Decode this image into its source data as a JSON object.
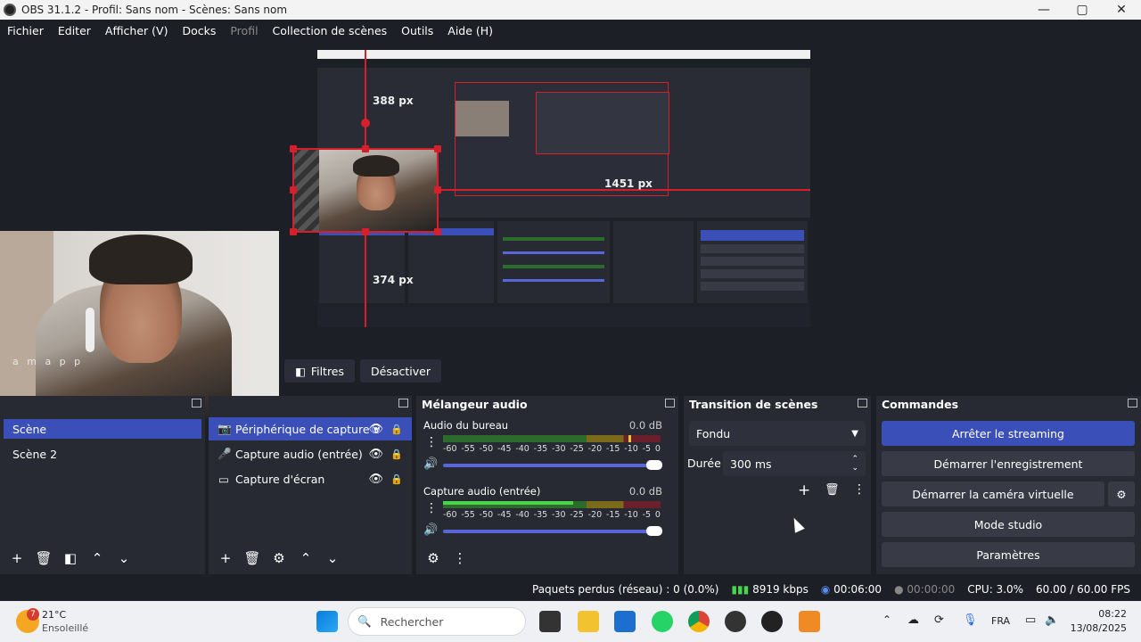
{
  "window": {
    "title": "OBS 31.1.2 - Profil: Sans nom - Scènes: Sans nom"
  },
  "menu": [
    "Fichier",
    "Editer",
    "Afficher (V)",
    "Docks",
    "Profil",
    "Collection de scènes",
    "Outils",
    "Aide (H)"
  ],
  "preview": {
    "measure_top": "388 px",
    "measure_bottom": "374 px",
    "measure_right": "1451 px"
  },
  "webcam": {
    "watermark": "a m a p p"
  },
  "filter_bar": {
    "filters": "Filtres",
    "deactivate": "Désactiver"
  },
  "scenes": {
    "items": [
      "Scène",
      "Scène 2"
    ]
  },
  "sources": {
    "items": [
      "Périphérique de capture v",
      "Capture audio (entrée)",
      "Capture d'écran"
    ]
  },
  "mixer": {
    "title": "Mélangeur audio",
    "channels": [
      {
        "name": "Audio du bureau",
        "db": "0.0 dB",
        "level": 0.0
      },
      {
        "name": "Capture audio (entrée)",
        "db": "0.0 dB",
        "level": 0.6
      }
    ],
    "scale": [
      "-60",
      "-55",
      "-50",
      "-45",
      "-40",
      "-35",
      "-30",
      "-25",
      "-20",
      "-15",
      "-10",
      "-5",
      "0"
    ]
  },
  "transitions": {
    "title": "Transition de scènes",
    "selected": "Fondu",
    "duration_label": "Durée",
    "duration_value": "300 ms"
  },
  "commands": {
    "title": "Commandes",
    "stop_streaming": "Arrêter le streaming",
    "start_recording": "Démarrer l'enregistrement",
    "start_virtualcam": "Démarrer la caméra virtuelle",
    "studio_mode": "Mode studio",
    "settings": "Paramètres"
  },
  "status": {
    "dropped": "Paquets perdus (réseau) : 0 (0.0%)",
    "bitrate": "8919 kbps",
    "stream_time": "00:06:00",
    "rec_time": "00:00:00",
    "cpu": "CPU: 3.0%",
    "fps": "60.00 / 60.00 FPS"
  },
  "taskbar": {
    "weather_temp": "21°C",
    "weather_desc": "Ensoleillé",
    "weather_badge": "7",
    "search_placeholder": "Rechercher",
    "lang": "FRA",
    "time": "08:22",
    "date": "13/08/2025"
  },
  "colors": {
    "accent": "#3b4fb8",
    "selection_red": "#d61f2a",
    "bg": "#1d1f26",
    "panel": "#272a33"
  }
}
